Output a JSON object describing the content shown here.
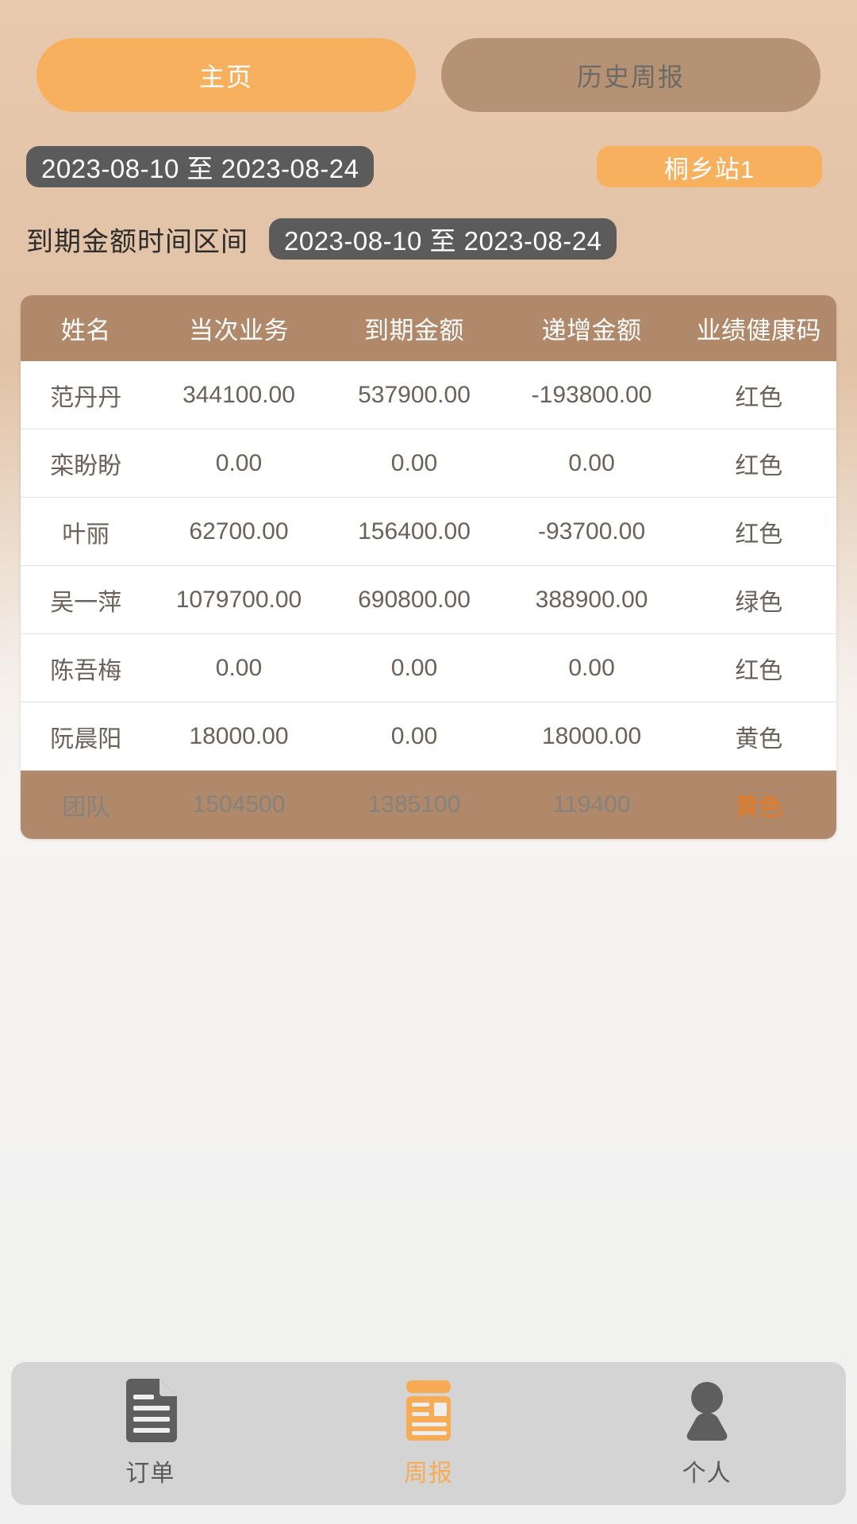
{
  "tabs": [
    {
      "label": "主页",
      "state": "active"
    },
    {
      "label": "历史周报",
      "state": "inactive"
    }
  ],
  "filters": {
    "date_range": "2023-08-10 至 2023-08-24",
    "station": "桐乡站1",
    "due_label": "到期金额时间区间",
    "due_date_range": "2023-08-10 至 2023-08-24"
  },
  "table": {
    "headers": [
      "姓名",
      "当次业务",
      "到期金额",
      "递增金额",
      "业绩健康码"
    ],
    "rows": [
      {
        "name": "范丹丹",
        "current": "344100.00",
        "due": "537900.00",
        "increment": "-193800.00",
        "code": "红色",
        "code_color": "red"
      },
      {
        "name": "栾盼盼",
        "current": "0.00",
        "due": "0.00",
        "increment": "0.00",
        "code": "红色",
        "code_color": "red"
      },
      {
        "name": "叶丽",
        "current": "62700.00",
        "due": "156400.00",
        "increment": "-93700.00",
        "code": "红色",
        "code_color": "red"
      },
      {
        "name": "吴一萍",
        "current": "1079700.00",
        "due": "690800.00",
        "increment": "388900.00",
        "code": "绿色",
        "code_color": "green"
      },
      {
        "name": "陈吾梅",
        "current": "0.00",
        "due": "0.00",
        "increment": "0.00",
        "code": "红色",
        "code_color": "red"
      },
      {
        "name": "阮晨阳",
        "current": "18000.00",
        "due": "0.00",
        "increment": "18000.00",
        "code": "黄色",
        "code_color": "yellow"
      }
    ],
    "total": {
      "name": "团队",
      "current": "1504500",
      "due": "1385100",
      "increment": "119400",
      "code": "黄色",
      "code_color": "yellow"
    }
  },
  "bottom_nav": [
    {
      "label": "订单",
      "icon": "document-icon",
      "state": "inactive"
    },
    {
      "label": "周报",
      "icon": "news-report-icon",
      "state": "active"
    },
    {
      "label": "个人",
      "icon": "person-icon",
      "state": "inactive"
    }
  ],
  "colors": {
    "accent_orange": "#f7b15e",
    "tab_inactive_brown": "#b69275",
    "table_header_brown": "#b0886a",
    "pill_dark": "#5b5b5b",
    "code_red": "#fa0d0d",
    "code_green": "#12a012",
    "code_yellow": "#f07818"
  }
}
